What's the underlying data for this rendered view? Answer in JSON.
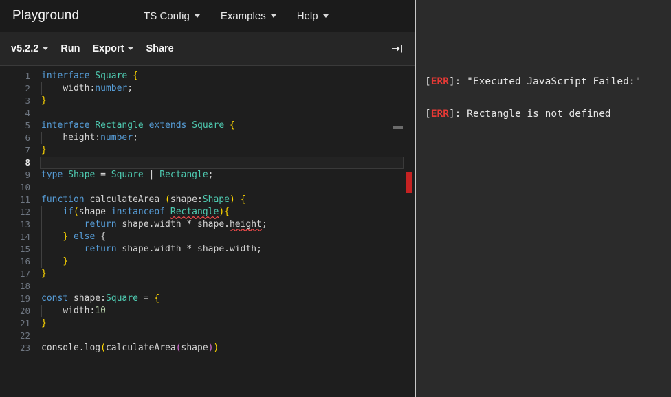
{
  "navbar": {
    "brand": "Playground",
    "items": [
      {
        "label": "TS Config",
        "has_caret": true,
        "name": "nav-ts-config"
      },
      {
        "label": "Examples",
        "has_caret": true,
        "name": "nav-examples"
      },
      {
        "label": "Help",
        "has_caret": true,
        "name": "nav-help"
      }
    ]
  },
  "toolbar": {
    "version_label": "v5.2.2",
    "run_label": "Run",
    "export_label": "Export",
    "share_label": "Share",
    "collapse_icon": "collapse-right-icon",
    "collapse_glyph": "→|"
  },
  "editor": {
    "language": "typescript",
    "active_line": 8,
    "total_lines": 23,
    "lines": [
      {
        "n": "1",
        "text": "interface Square {"
      },
      {
        "n": "2",
        "text": "    width:number;"
      },
      {
        "n": "3",
        "text": "}"
      },
      {
        "n": "4",
        "text": ""
      },
      {
        "n": "5",
        "text": "interface Rectangle extends Square {"
      },
      {
        "n": "6",
        "text": "    height:number;"
      },
      {
        "n": "7",
        "text": "}"
      },
      {
        "n": "8",
        "text": ""
      },
      {
        "n": "9",
        "text": "type Shape = Square | Rectangle;"
      },
      {
        "n": "10",
        "text": ""
      },
      {
        "n": "11",
        "text": "function calculateArea (shape:Shape) {"
      },
      {
        "n": "12",
        "text": "    if(shape instanceof Rectangle){"
      },
      {
        "n": "13",
        "text": "        return shape.width * shape.height;"
      },
      {
        "n": "14",
        "text": "    } else {"
      },
      {
        "n": "15",
        "text": "        return shape.width * shape.width;"
      },
      {
        "n": "16",
        "text": "    }"
      },
      {
        "n": "17",
        "text": "}"
      },
      {
        "n": "18",
        "text": ""
      },
      {
        "n": "19",
        "text": "const shape:Square = {"
      },
      {
        "n": "20",
        "text": "    width:10"
      },
      {
        "n": "21",
        "text": "}"
      },
      {
        "n": "22",
        "text": ""
      },
      {
        "n": "23",
        "text": "console.log(calculateArea(shape))"
      }
    ],
    "squiggle_lines": [
      12,
      13
    ],
    "error_marker_line": 9,
    "colors": {
      "background": "#1e1e1e",
      "keyword": "#569cd6",
      "type": "#4ec9b0",
      "bracket_1": "#ffd700",
      "bracket_2": "#da70d6",
      "plain": "#d4d4d4",
      "number_literal": "#b5cea8",
      "line_number": "#6e7681",
      "error_squiggle": "#f14c4c",
      "error_ruler_mark": "#c62222"
    }
  },
  "errors": {
    "entries": [
      {
        "tag": "ERR",
        "message": "\"Executed JavaScript Failed:\""
      },
      {
        "tag": "ERR",
        "message": "Rectangle is not defined"
      }
    ],
    "tag_color": "#e53935"
  }
}
